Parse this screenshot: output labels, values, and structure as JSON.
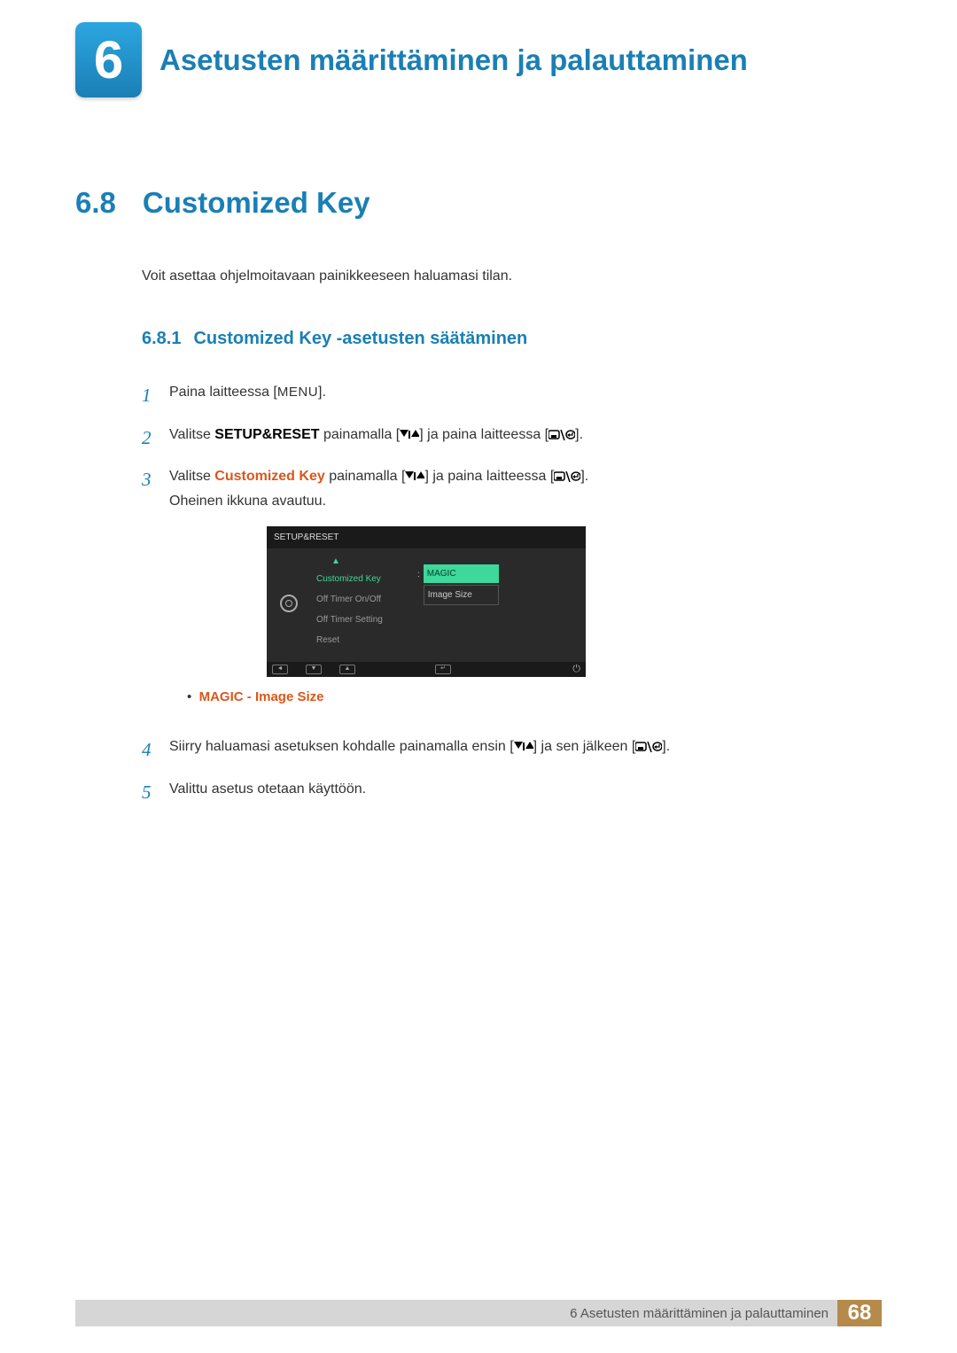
{
  "chapter": {
    "number": "6",
    "title": "Asetusten määrittäminen ja palauttaminen"
  },
  "section": {
    "number": "6.8",
    "title": "Customized Key",
    "intro": "Voit asettaa ohjelmoitavaan painikkeeseen haluamasi tilan."
  },
  "subsection": {
    "number": "6.8.1",
    "title": "Customized Key -asetusten säätäminen"
  },
  "steps": {
    "s1_pre": "Paina laitteessa [",
    "s1_menu": "MENU",
    "s1_post": "].",
    "s2_pre": "Valitse ",
    "s2_bold": "SETUP&RESET",
    "s2_mid1": " painamalla [",
    "s2_mid2": "] ja paina laitteessa [",
    "s2_post": "].",
    "s3_pre": "Valitse ",
    "s3_bold": "Customized Key",
    "s3_mid1": " painamalla [",
    "s3_mid2": "] ja paina laitteessa [",
    "s3_post": "].",
    "s3_extra": "Oheinen ikkuna avautuu.",
    "s4_pre": "Siirry haluamasi asetuksen kohdalle painamalla ensin [",
    "s4_mid": "] ja sen jälkeen [",
    "s4_post": "].",
    "s5": "Valittu asetus otetaan käyttöön."
  },
  "step_nums": {
    "n1": "1",
    "n2": "2",
    "n3": "3",
    "n4": "4",
    "n5": "5"
  },
  "osd": {
    "header": "SETUP&RESET",
    "items": {
      "i1": "Customized Key",
      "i2": "Off Timer On/Off",
      "i3": "Off Timer Setting",
      "i4": "Reset"
    },
    "val1": "MAGIC",
    "val2": "Image Size",
    "colon": ":"
  },
  "bullet": {
    "magic": "MAGIC",
    "sep": " - ",
    "imagesize": "Image Size"
  },
  "footer": {
    "text": "6 Asetusten määrittäminen ja palauttaminen",
    "page": "68"
  }
}
